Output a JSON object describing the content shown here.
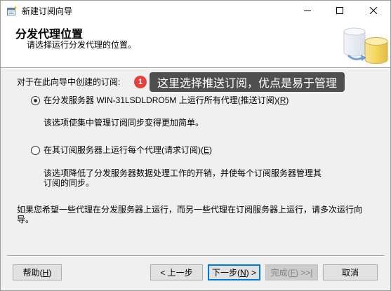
{
  "window": {
    "title": "新建订阅向导",
    "icon": "wizard-icon",
    "controls": {
      "minimize": "minimize-icon",
      "maximize": "maximize-icon",
      "close": "close-icon"
    }
  },
  "header": {
    "title": "分发代理位置",
    "subtitle": "请选择运行分发代理的位置。",
    "icon": "database-agent-icon"
  },
  "main": {
    "prompt": "对于在此向导中创建的订阅:",
    "options": [
      {
        "label": "在分发服务器 WIN-31LSDLDRO5M 上运行所有代理(推送订阅)(R)",
        "accesskey": "R",
        "selected": true,
        "description": [
          "该选项使集中管理订阅同步变得更加简单。"
        ]
      },
      {
        "label": "在其订阅服务器上运行每个代理(请求订阅)(E)",
        "accesskey": "E",
        "selected": false,
        "description": [
          "该选项降低了分发服务器数据处理工作的开销，并使每个订阅服务器管理其",
          "订阅的同步。"
        ]
      }
    ],
    "note": [
      "如果您希望一些代理在分发服务器上运行，而另一些代理在订阅服务器上运行，请多次运行向",
      "导。"
    ]
  },
  "annotation": {
    "badge": "1",
    "text": "这里选择推送订阅，优点是易于管理"
  },
  "buttons": {
    "help": {
      "label": "帮助(H)",
      "accesskey": "H",
      "enabled": true,
      "default": false
    },
    "back": {
      "label": "< 上一步",
      "enabled": true,
      "default": false
    },
    "next": {
      "label": "下一步(N) >",
      "accesskey": "N",
      "enabled": true,
      "default": true
    },
    "finish": {
      "label": "完成(F) >>|",
      "accesskey": "F",
      "enabled": false,
      "default": false
    },
    "cancel": {
      "label": "取消",
      "enabled": true,
      "default": false
    }
  },
  "colors": {
    "accent": "#0078d7",
    "badge": "#e5413a",
    "tooltip": "#4f4f4f",
    "header_bg": "#ffffff",
    "dialog_bg": "#f0f0f0"
  }
}
